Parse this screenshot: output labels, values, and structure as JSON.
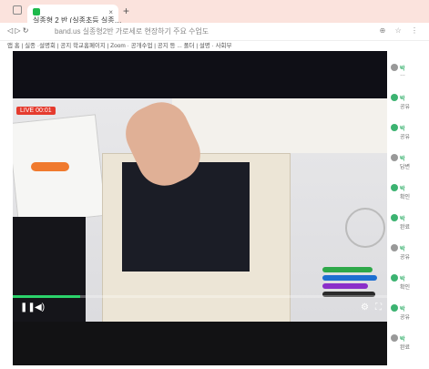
{
  "tab": {
    "title": "실종형 2 반 (실종초등 실종…",
    "close": "×",
    "new_tab": "+"
  },
  "address": {
    "nav": "◁ ▷ ↻",
    "url": "band.us  실종형2반 가로세로 현장하기 주요 수업도",
    "icons": "⊕ ☆ ⋮"
  },
  "bookmarks": "앱 홈 | 실종 ·설명회 | 공지 학교홈페이지 | Zoom · 공개수업 | 공지 등 ... 폴더 | 설명 · 사회부",
  "video": {
    "live_badge": "LIVE 00:01",
    "progress_pct": 18
  },
  "controls": {
    "play": "❚❚",
    "volume": "◀)",
    "settings": "⚙",
    "fullscreen": "⛶"
  },
  "sidebar": {
    "items": [
      {
        "name": "박",
        "text": "…"
      },
      {
        "name": "박",
        "text": "공유"
      },
      {
        "name": "박",
        "text": "공유"
      },
      {
        "name": "박",
        "text": "답변"
      },
      {
        "name": "박",
        "text": "확인"
      },
      {
        "name": "박",
        "text": "완료"
      },
      {
        "name": "박",
        "text": "공유"
      },
      {
        "name": "박",
        "text": "확인"
      },
      {
        "name": "박",
        "text": "공유"
      },
      {
        "name": "박",
        "text": "완료"
      }
    ]
  }
}
